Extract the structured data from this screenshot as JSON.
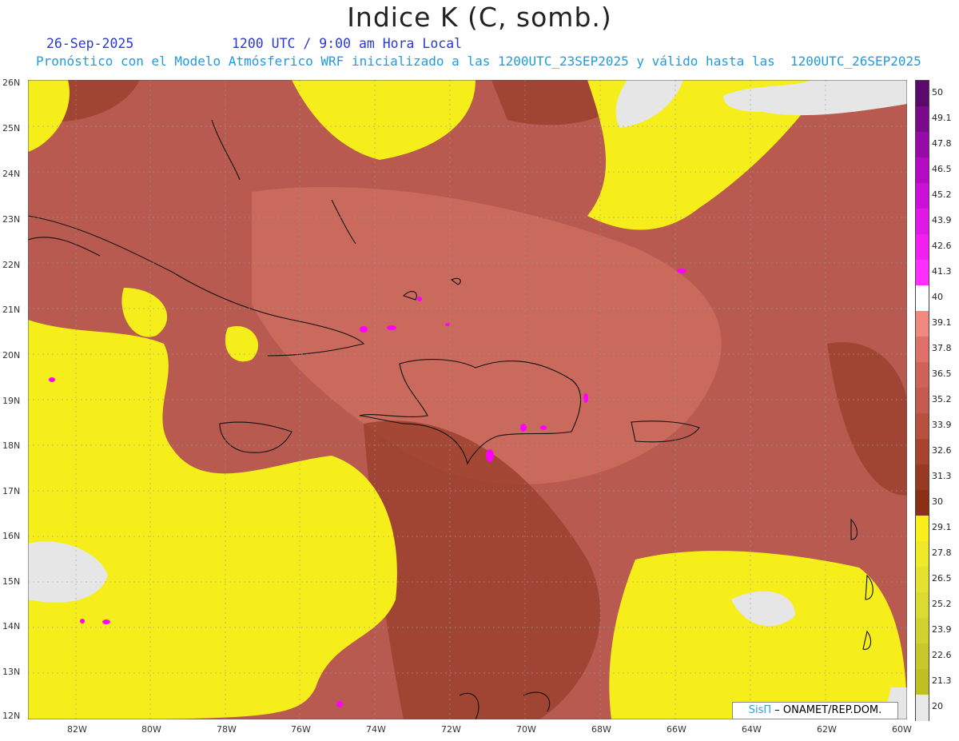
{
  "header": {
    "title": "Indice K (C, somb.)",
    "date": "26-Sep-2025",
    "time": "1200 UTC / 9:00 am Hora Local",
    "description": "Pronóstico con el Modelo Atmósferico WRF inicializado a las 1200UTC_23SEP2025 y válido hasta las  1200UTC_26SEP2025"
  },
  "map": {
    "lat_labels": [
      "26N",
      "25N",
      "24N",
      "23N",
      "22N",
      "21N",
      "20N",
      "19N",
      "18N",
      "17N",
      "16N",
      "15N",
      "14N",
      "13N",
      "12N"
    ],
    "lon_labels": [
      "82W",
      "80W",
      "78W",
      "76W",
      "74W",
      "72W",
      "70W",
      "68W",
      "66W",
      "64W",
      "62W",
      "60W"
    ],
    "colors": {
      "high": "#b85a50",
      "very_high": "#9a3f2c",
      "mid": "#d07060",
      "low": "#f6ee1a",
      "none": "#e6e6e6",
      "extreme": "#ff00ff"
    }
  },
  "colorbar": {
    "labels": [
      "50",
      "49.1",
      "47.8",
      "46.5",
      "45.2",
      "43.9",
      "42.6",
      "41.3",
      "40",
      "39.1",
      "37.8",
      "36.5",
      "35.2",
      "33.9",
      "32.6",
      "31.3",
      "30",
      "29.1",
      "27.8",
      "26.5",
      "25.2",
      "23.9",
      "22.6",
      "21.3",
      "20"
    ],
    "colors": [
      "#5a0a6a",
      "#7a0a8a",
      "#980aa8",
      "#b40ac4",
      "#cc10d8",
      "#e018e8",
      "#f020f0",
      "#ff30ff",
      "#ffffff",
      "#f08a80",
      "#e0706a",
      "#cf6358",
      "#c55a50",
      "#b8503f",
      "#a8442e",
      "#983a22",
      "#8a3015",
      "#f8f018",
      "#eeea28",
      "#e4e22e",
      "#dada30",
      "#d2d22e",
      "#c8c82c",
      "#c0c026",
      "#e8e8e8"
    ]
  },
  "credit": {
    "logo": "SisΠ",
    "text": "– ONAMET/REP.DOM."
  }
}
